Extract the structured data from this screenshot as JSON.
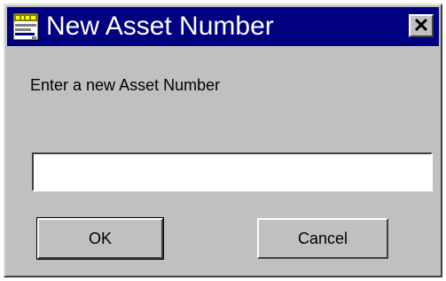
{
  "dialog": {
    "title": "New Asset Number",
    "close_label": "✕",
    "prompt": "Enter a new Asset Number",
    "input": {
      "value": "",
      "placeholder": ""
    },
    "ok_label": "OK",
    "cancel_label": "Cancel"
  },
  "icons": {
    "app": "app-icon",
    "close": "close-icon"
  },
  "colors": {
    "titlebar": "#000080",
    "face": "#c0c0c0",
    "field": "#ffffff"
  }
}
